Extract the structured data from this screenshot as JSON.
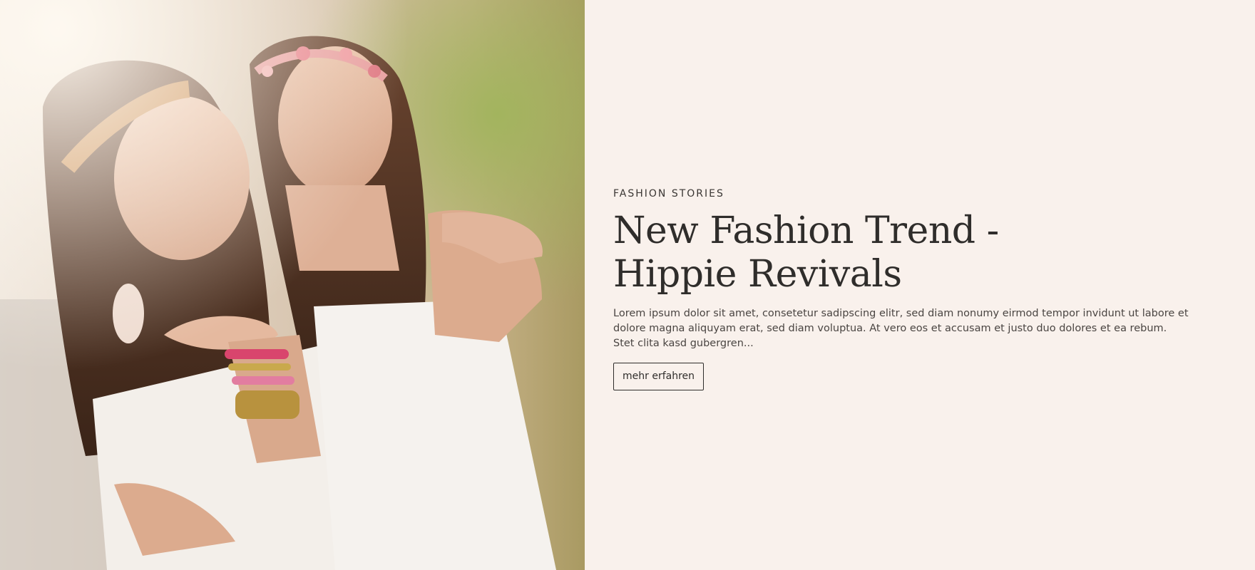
{
  "hero": {
    "image": {
      "alt_subject": "two-women-hippie-fashion-photo"
    },
    "kicker": "FASHION STORIES",
    "headline_line1": "New Fashion Trend -",
    "headline_line2": "Hippie Revivals",
    "body": "Lorem ipsum dolor sit amet, consetetur sadipscing elitr, sed diam nonumy eirmod tempor invidunt ut labore et dolore magna aliquyam erat, sed diam voluptua. At vero eos et accusam et justo duo dolores et ea rebum. Stet clita kasd gubergren...",
    "cta_label": "mehr erfahren"
  },
  "colors": {
    "background": "#f9f1ec",
    "text": "#2f2d2b"
  }
}
